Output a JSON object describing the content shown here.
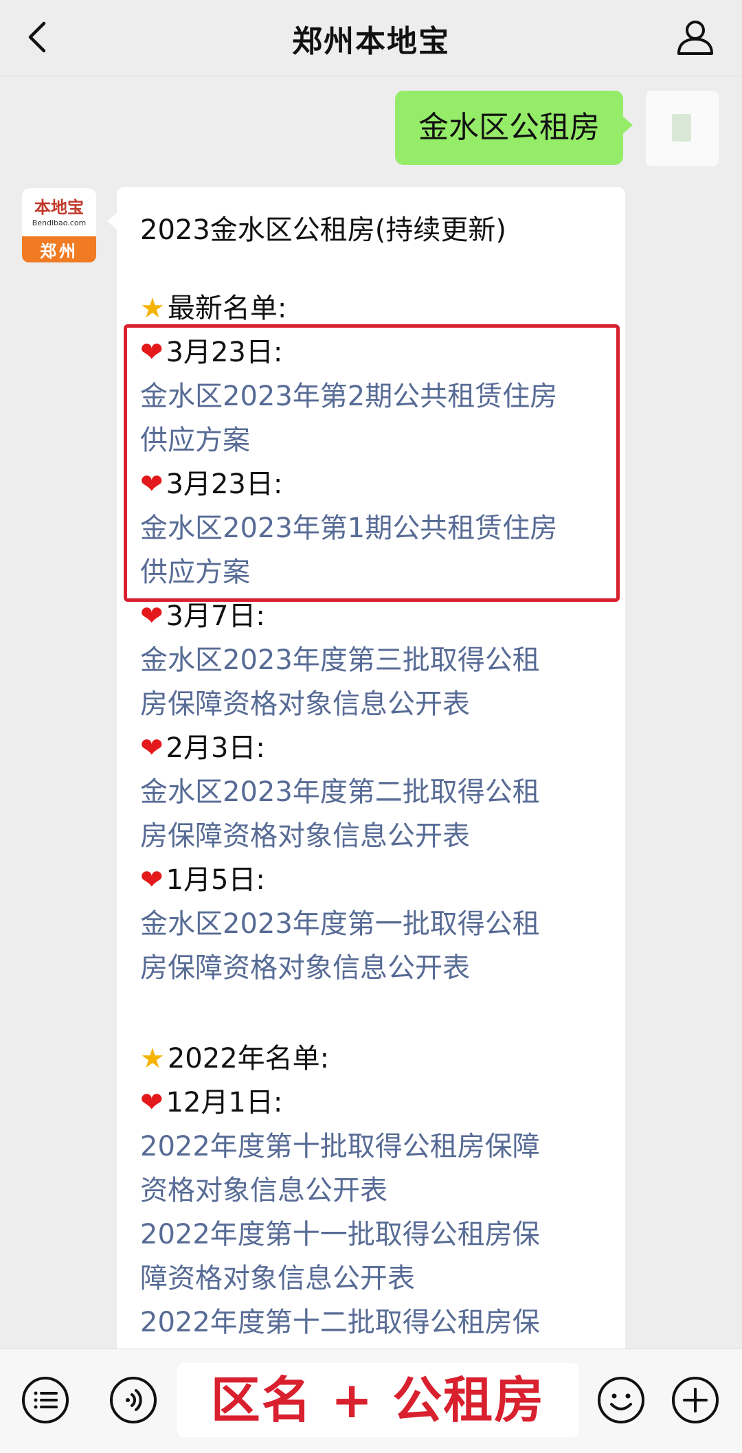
{
  "header": {
    "title": "郑州本地宝"
  },
  "outgoing": {
    "text": "金水区公租房"
  },
  "bot": {
    "brand": "本地宝",
    "domain": "Bendibao.com",
    "city": "郑州"
  },
  "message": {
    "title": "2023金水区公租房(持续更新)",
    "section_latest": "最新名单:",
    "entries_2023": [
      {
        "date": "3月23日:",
        "line1": "金水区2023年第2期公共租赁住房",
        "line2": "供应方案"
      },
      {
        "date": "3月23日:",
        "line1": "金水区2023年第1期公共租赁住房",
        "line2": "供应方案"
      },
      {
        "date": "3月7日:",
        "line1": "金水区2023年度第三批取得公租",
        "line2": "房保障资格对象信息公开表"
      },
      {
        "date": "2月3日:",
        "line1": "金水区2023年度第二批取得公租",
        "line2": "房保障资格对象信息公开表"
      },
      {
        "date": "1月5日:",
        "line1": "金水区2023年度第一批取得公租",
        "line2": "房保障资格对象信息公开表"
      }
    ],
    "section_2022": "2022年名单:",
    "entry_2022_date": "12月1日:",
    "links_2022": [
      "2022年度第十批取得公租房保障",
      "资格对象信息公开表",
      "2022年度第十一批取得公租房保",
      "障资格对象信息公开表",
      "2022年度第十二批取得公租房保"
    ]
  },
  "footer": {
    "input_text": "区名 + 公租房"
  },
  "icons": {
    "back": "chevron-left-icon",
    "profile": "person-icon",
    "menu": "menu-icon",
    "voice": "voice-icon",
    "emoji": "emoji-icon",
    "plus": "plus-icon"
  },
  "colors": {
    "link": "#576b95",
    "highlight": "#d9202e",
    "outgoing_bubble": "#95ec69"
  }
}
